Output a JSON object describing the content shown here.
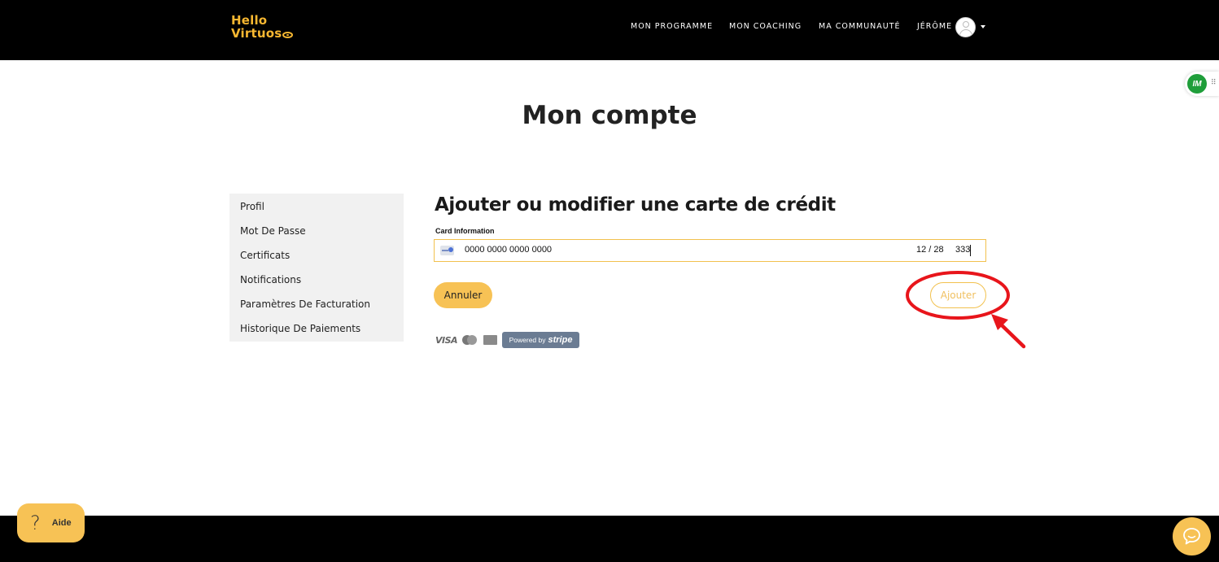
{
  "header": {
    "logo_line1": "Hello",
    "logo_line2": "Virtuos",
    "nav": [
      "MON PROGRAMME",
      "MON COACHING",
      "MA COMMUNAUTÉ",
      "JÉRÔME"
    ]
  },
  "extension": {
    "badge": "IM",
    "handle": "⠿"
  },
  "page": {
    "title": "Mon compte"
  },
  "sidebar": {
    "items": [
      {
        "label": "Profil"
      },
      {
        "label": "Mot De Passe"
      },
      {
        "label": "Certificats"
      },
      {
        "label": "Notifications"
      },
      {
        "label": "Paramètres De Facturation"
      },
      {
        "label": "Historique De Paiements"
      }
    ]
  },
  "card_form": {
    "title": "Ajouter ou modifier une carte de crédit",
    "label": "Card Information",
    "card_number": "0000 0000 0000 0000",
    "expiry": "12 / 28",
    "cvc": "333",
    "cancel_label": "Annuler",
    "add_label": "Ajouter"
  },
  "payment_logos": {
    "visa": "VISA",
    "stripe_prefix": "Powered by",
    "stripe_brand": "stripe"
  },
  "footer": {
    "help_icon": "?",
    "help_label": "Aide"
  },
  "colors": {
    "accent": "#f7c255",
    "header_bg": "#000000",
    "annotation": "#e8151b",
    "extension_green": "#1f9e3a"
  }
}
